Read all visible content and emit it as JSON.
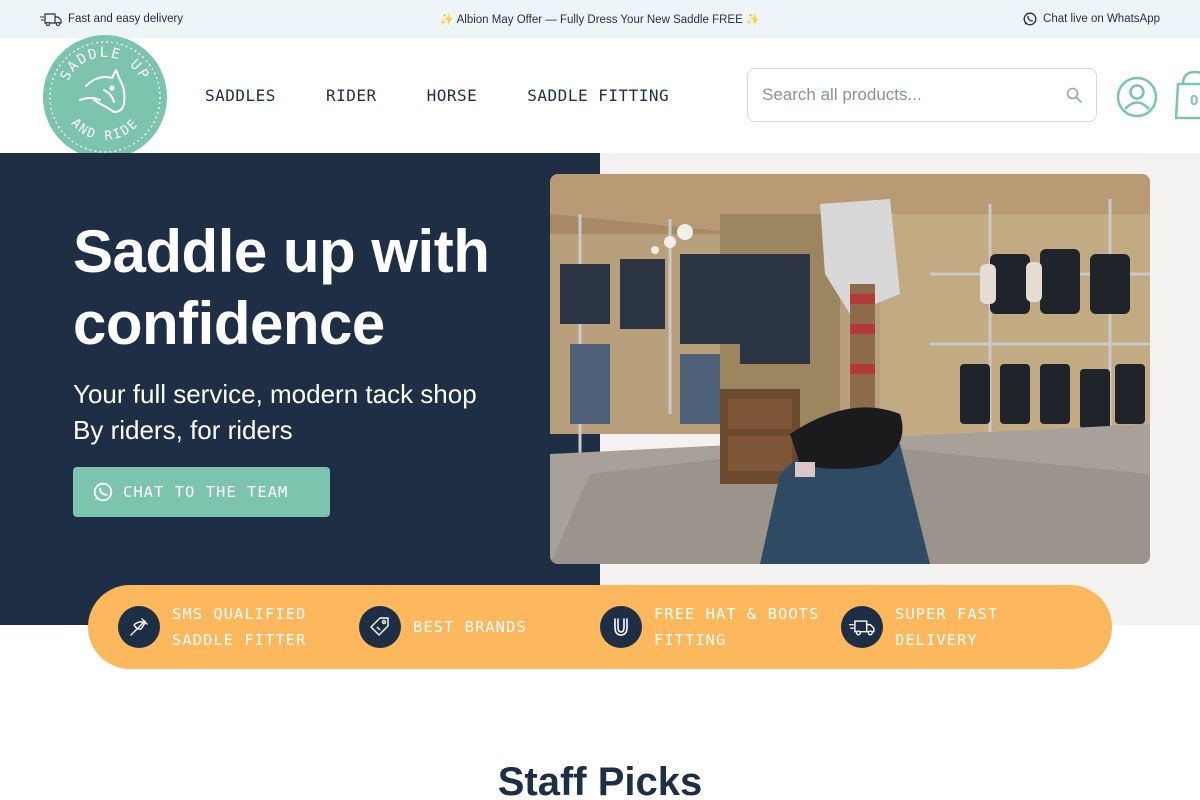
{
  "topbar": {
    "delivery": "Fast and easy delivery",
    "offer": "✨ Albion May Offer — Fully Dress Your New Saddle FREE ✨",
    "whatsapp": "Chat live on WhatsApp"
  },
  "logo": {
    "top_text": "SADDLE UP",
    "bottom_text": "AND RIDE"
  },
  "nav": {
    "items": [
      {
        "label": "SADDLES"
      },
      {
        "label": "RIDER"
      },
      {
        "label": "HORSE"
      },
      {
        "label": "SADDLE FITTING"
      }
    ]
  },
  "search": {
    "placeholder": "Search all products..."
  },
  "cart": {
    "count": "0"
  },
  "hero": {
    "title": "Saddle up with confidence",
    "subtitle_line1": "Your full service, modern tack shop",
    "subtitle_line2": "By riders, for riders",
    "cta_label": "CHAT TO THE TEAM"
  },
  "usps": [
    {
      "icon": "saddle-fitter-icon",
      "line1": "SMS QUALIFIED",
      "line2": "SADDLE FITTER"
    },
    {
      "icon": "price-tag-icon",
      "line1": "BEST BRANDS",
      "line2": ""
    },
    {
      "icon": "horseshoe-icon",
      "line1": "FREE HAT & BOOTS",
      "line2": "FITTING"
    },
    {
      "icon": "delivery-truck-icon",
      "line1": "SUPER FAST",
      "line2": "DELIVERY"
    }
  ],
  "section": {
    "staff_picks": "Staff Picks"
  },
  "colors": {
    "navy": "#1e2f45",
    "mint": "#7cc4ad",
    "orange": "#fdb75c",
    "topbar_bg": "#eef5f8"
  }
}
